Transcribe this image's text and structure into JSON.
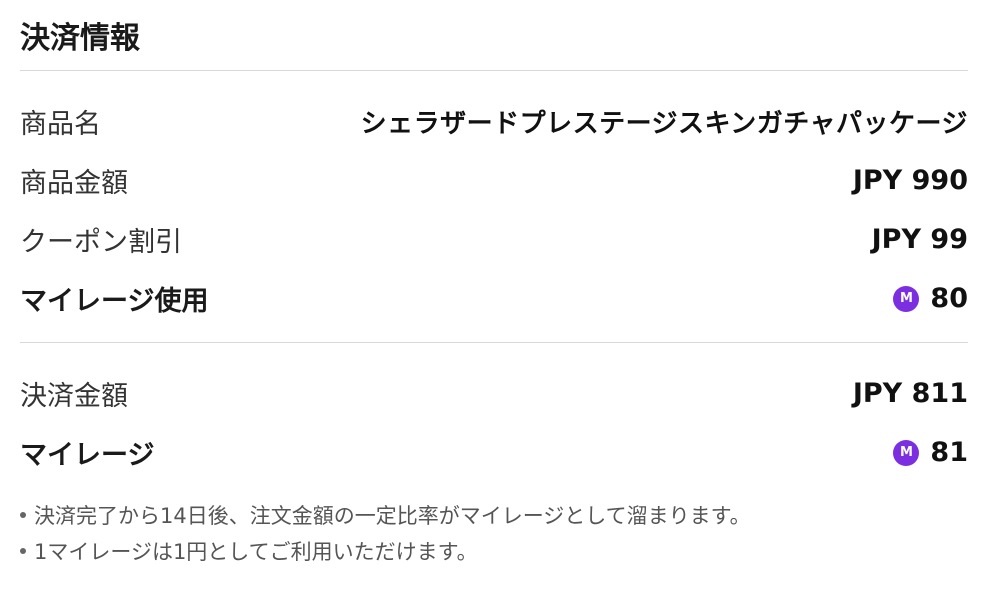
{
  "header": {
    "title": "決済情報"
  },
  "details": {
    "product_name": {
      "label": "商品名",
      "value": "シェラザードプレステージスキンガチャパッケージ"
    },
    "product_amount": {
      "label": "商品金額",
      "value": "JPY 990"
    },
    "coupon_discount": {
      "label": "クーポン割引",
      "value": "JPY 99"
    },
    "mileage_used": {
      "label": "マイレージ使用",
      "badge": "M",
      "value": "80"
    }
  },
  "summary": {
    "payment_amount": {
      "label": "決済金額",
      "value": "JPY 811"
    },
    "mileage": {
      "label": "マイレージ",
      "badge": "M",
      "value": "81"
    }
  },
  "notes": [
    "決済完了から14日後、注文金額の一定比率がマイレージとして溜まります。",
    "1マイレージは1円としてご利用いただけます。"
  ],
  "colors": {
    "mileage_badge": "#7b2fe0",
    "divider": "#d9d9d9"
  },
  "icons": {
    "mileage": "mileage-coin-icon"
  }
}
